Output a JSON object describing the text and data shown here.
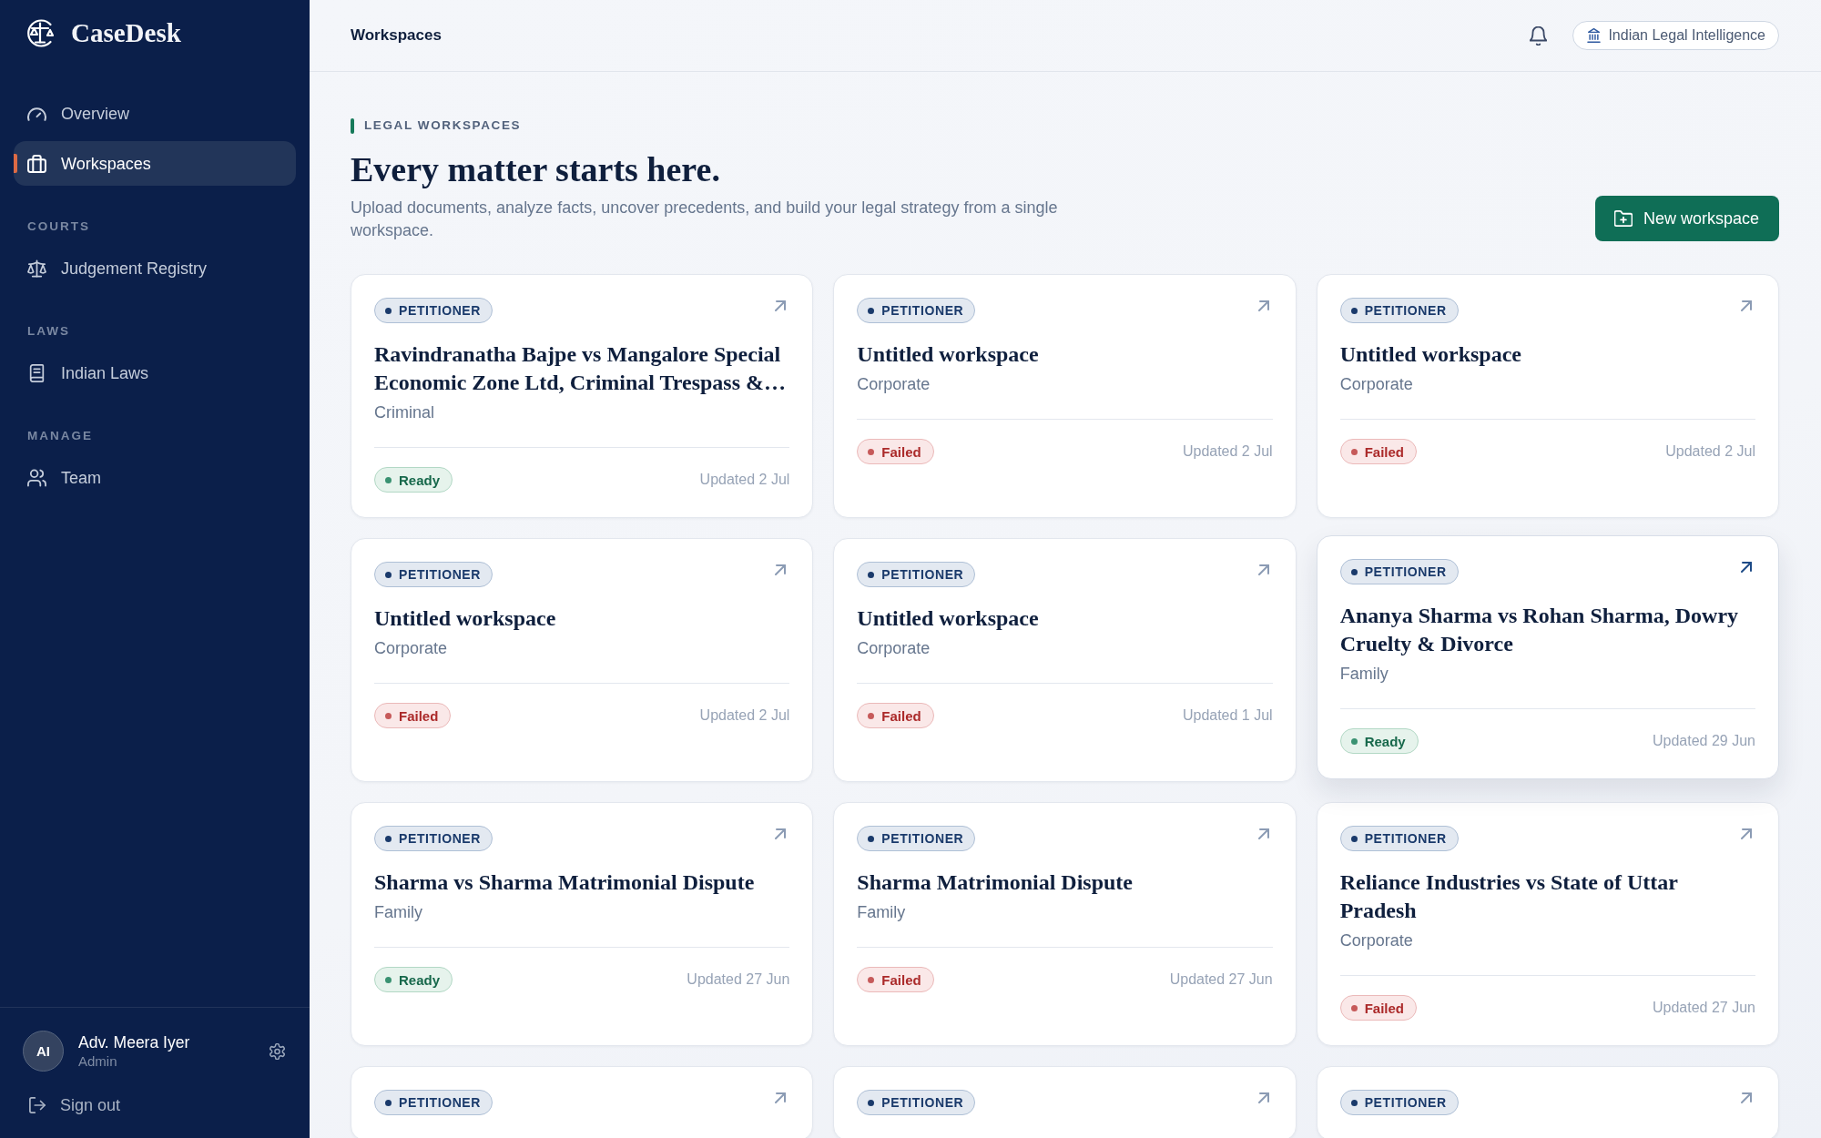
{
  "sidebar": {
    "brand": "CaseDesk",
    "sections": [
      {
        "items": [
          {
            "label": "Overview",
            "selected": false
          },
          {
            "label": "Workspaces",
            "selected": true
          }
        ]
      },
      {
        "heading": "COURTS",
        "items": [
          {
            "label": "Judgement Registry",
            "selected": false
          }
        ]
      },
      {
        "heading": "LAWS",
        "items": [
          {
            "label": "Indian Laws",
            "selected": false
          }
        ]
      },
      {
        "heading": "MANAGE",
        "items": [
          {
            "label": "Team",
            "selected": false
          }
        ]
      }
    ],
    "user": {
      "initials": "AI",
      "name": "Adv. Meera Iyer",
      "role": "Admin"
    },
    "sign_out": "Sign out"
  },
  "header": {
    "title": "Workspaces",
    "badge": "Indian Legal Intelligence"
  },
  "hero": {
    "eyebrow": "LEGAL WORKSPACES",
    "headline": "Every matter starts here.",
    "description": "Upload documents, analyze facts, uncover precedents, and build your legal strategy from a single workspace.",
    "button": "New workspace"
  },
  "workspaces": [
    {
      "tag": "PETITIONER",
      "title": "Ravindranatha Bajpe vs Mangalore Special Economic Zone Ltd, Criminal Trespass &…",
      "category": "Criminal",
      "status": {
        "label": "Ready",
        "kind": "ready"
      },
      "updated": "Updated 2 Jul",
      "hovered": false
    },
    {
      "tag": "PETITIONER",
      "title": "Untitled workspace",
      "category": "Corporate",
      "status": {
        "label": "Failed",
        "kind": "failed"
      },
      "updated": "Updated 2 Jul",
      "hovered": false
    },
    {
      "tag": "PETITIONER",
      "title": "Untitled workspace",
      "category": "Corporate",
      "status": {
        "label": "Failed",
        "kind": "failed"
      },
      "updated": "Updated 2 Jul",
      "hovered": false
    },
    {
      "tag": "PETITIONER",
      "title": "Untitled workspace",
      "category": "Corporate",
      "status": {
        "label": "Failed",
        "kind": "failed"
      },
      "updated": "Updated 2 Jul",
      "hovered": false
    },
    {
      "tag": "PETITIONER",
      "title": "Untitled workspace",
      "category": "Corporate",
      "status": {
        "label": "Failed",
        "kind": "failed"
      },
      "updated": "Updated 1 Jul",
      "hovered": false
    },
    {
      "tag": "PETITIONER",
      "title": "Ananya Sharma vs Rohan Sharma, Dowry Cruelty & Divorce",
      "category": "Family",
      "status": {
        "label": "Ready",
        "kind": "ready"
      },
      "updated": "Updated 29 Jun",
      "hovered": true
    },
    {
      "tag": "PETITIONER",
      "title": "Sharma vs Sharma Matrimonial Dispute",
      "category": "Family",
      "status": {
        "label": "Ready",
        "kind": "ready"
      },
      "updated": "Updated 27 Jun",
      "hovered": false
    },
    {
      "tag": "PETITIONER",
      "title": "Sharma Matrimonial Dispute",
      "category": "Family",
      "status": {
        "label": "Failed",
        "kind": "failed"
      },
      "updated": "Updated 27 Jun",
      "hovered": false
    },
    {
      "tag": "PETITIONER",
      "title": "Reliance Industries vs State of Uttar Pradesh",
      "category": "Corporate",
      "status": {
        "label": "Failed",
        "kind": "failed"
      },
      "updated": "Updated 27 Jun",
      "hovered": false
    },
    {
      "tag": "PETITIONER",
      "hovered": false
    },
    {
      "tag": "PETITIONER",
      "hovered": false
    },
    {
      "tag": "PETITIONER",
      "hovered": false
    }
  ]
}
